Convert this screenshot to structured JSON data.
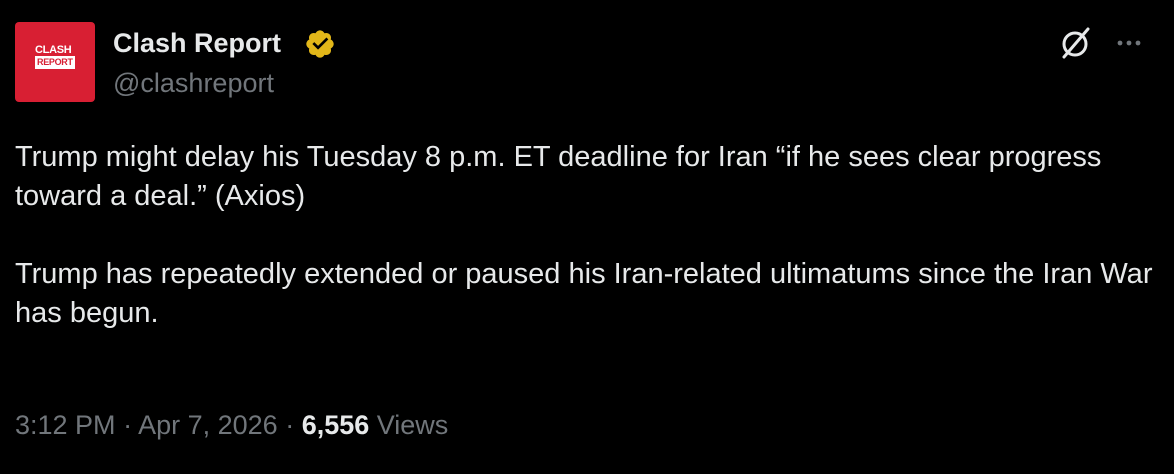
{
  "author": {
    "name": "Clash Report",
    "handle": "@clashreport",
    "avatar_logo_line1": "CLASH",
    "avatar_logo_line2": "REPORT",
    "verified_badge": "verified-gold-icon"
  },
  "actions": {
    "grok_icon": "grok-icon",
    "more_icon": "more-icon"
  },
  "tweet": {
    "paragraph1": "Trump might delay his Tuesday 8 p.m. ET deadline for Iran “if he sees clear progress toward a deal.” (Axios)",
    "paragraph2": "Trump has repeatedly extended or paused his Iran-related ultimatums since the Iran War has begun."
  },
  "meta": {
    "time": "3:12 PM",
    "separator1": " · ",
    "date": "Apr 7, 2026",
    "separator2": " · ",
    "views_count": "6,556",
    "views_label": " Views"
  },
  "colors": {
    "background": "#000000",
    "text_primary": "#e7e9ea",
    "text_secondary": "#71767b",
    "avatar_red": "#d81f33",
    "verified_gold": "#e2b719"
  }
}
